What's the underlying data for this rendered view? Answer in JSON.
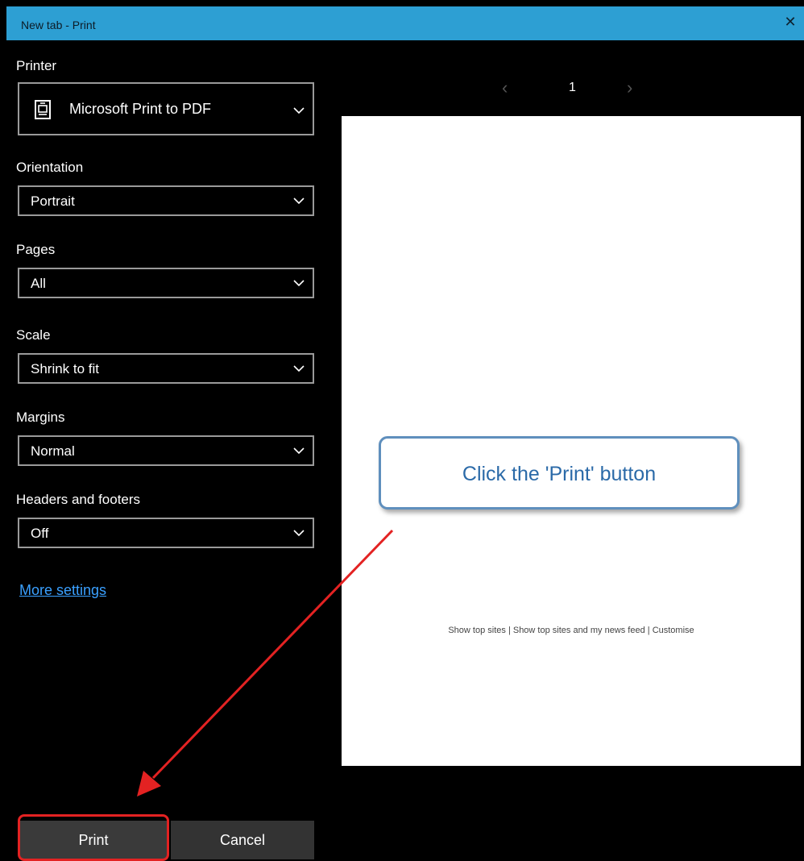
{
  "window": {
    "title": "New tab - Print",
    "close_label": "✕"
  },
  "settings": {
    "printer": {
      "label": "Printer",
      "value": "Microsoft Print to PDF"
    },
    "orientation": {
      "label": "Orientation",
      "value": "Portrait"
    },
    "pages": {
      "label": "Pages",
      "value": "All"
    },
    "scale": {
      "label": "Scale",
      "value": "Shrink to fit"
    },
    "margins": {
      "label": "Margins",
      "value": "Normal"
    },
    "headers_footers": {
      "label": "Headers and footers",
      "value": "Off"
    },
    "more_settings": "More settings"
  },
  "buttons": {
    "print": "Print",
    "cancel": "Cancel"
  },
  "preview": {
    "page_number": "1",
    "prev_glyph": "‹",
    "next_glyph": "›",
    "page_text": "Show top sites | Show top sites and my news feed | Customise"
  },
  "callout": {
    "text": "Click the 'Print' button"
  },
  "colors": {
    "titlebar": "#2d9fd3",
    "link": "#3aa0ff",
    "highlight": "#e32222",
    "callout_border": "#5f8fbd",
    "callout_text": "#2b6aa8"
  }
}
